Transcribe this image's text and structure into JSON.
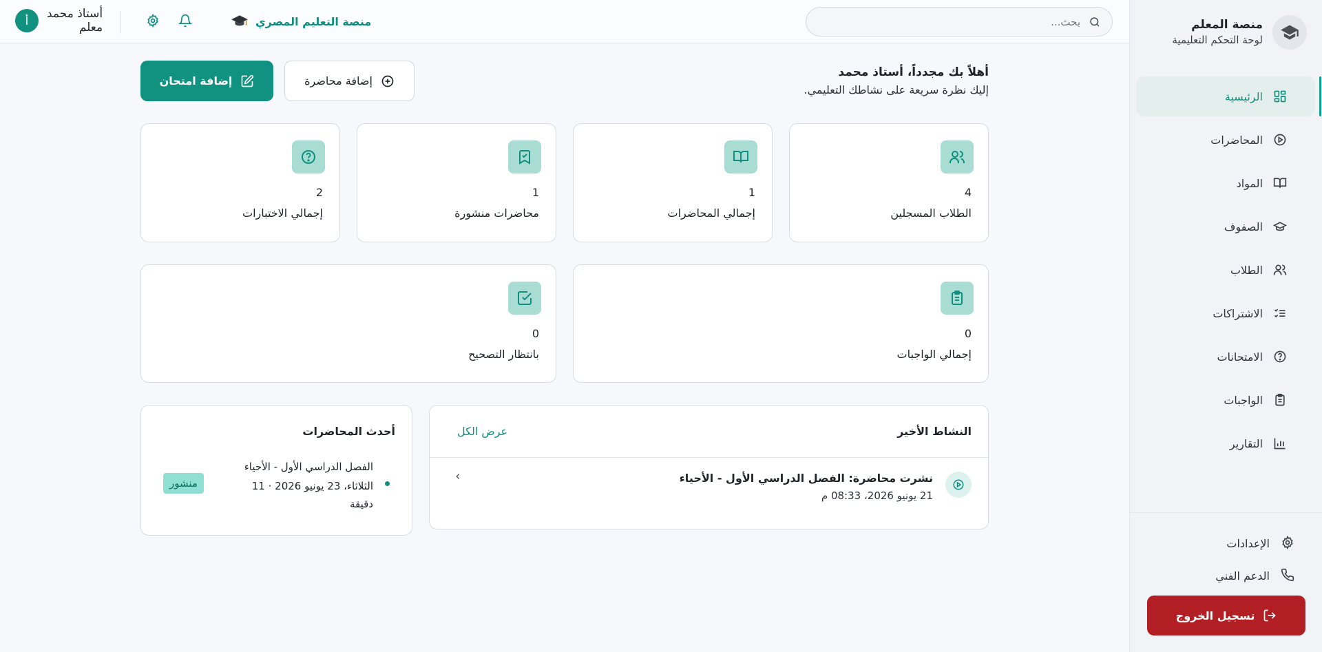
{
  "sidebar": {
    "brand_title": "منصة المعلم",
    "brand_subtitle": "لوحة التحكم التعليمية",
    "items": [
      {
        "label": "الرئيسية",
        "active": true
      },
      {
        "label": "المحاضرات"
      },
      {
        "label": "المواد"
      },
      {
        "label": "الصفوف"
      },
      {
        "label": "الطلاب"
      },
      {
        "label": "الاشتراكات"
      },
      {
        "label": "الامتحانات"
      },
      {
        "label": "الواجبات"
      },
      {
        "label": "التقارير"
      }
    ],
    "settings_label": "الإعدادات",
    "support_label": "الدعم الفني",
    "logout_label": "تسجيل الخروج"
  },
  "topbar": {
    "search_placeholder": "بحث...",
    "platform_name": "منصة التعليم المصري",
    "user_name": "أستاذ محمد",
    "user_role": "معلم",
    "user_initial": "أ"
  },
  "welcome": {
    "title": "أهلاً بك مجدداً، أستاذ محمد",
    "subtitle": "إليك نظرة سريعة على نشاطك التعليمي."
  },
  "actions": {
    "add_lecture": "إضافة محاضرة",
    "add_exam": "إضافة امتحان"
  },
  "stats": [
    {
      "value": "4",
      "label": "الطلاب المسجلين",
      "icon": "users-icon"
    },
    {
      "value": "1",
      "label": "إجمالي المحاضرات",
      "icon": "book-open-icon"
    },
    {
      "value": "1",
      "label": "محاضرات منشورة",
      "icon": "bookmark-check-icon"
    },
    {
      "value": "2",
      "label": "إجمالي الاختبارات",
      "icon": "help-circle-icon"
    },
    {
      "value": "0",
      "label": "إجمالي الواجبات",
      "icon": "clipboard-list-icon"
    },
    {
      "value": "0",
      "label": "بانتظار التصحيح",
      "icon": "check-square-icon"
    }
  ],
  "activity": {
    "title": "النشاط الأخير",
    "view_all": "عرض الكل",
    "items": [
      {
        "title": "نشرت محاضرة: الفصل الدراسي الأول - الأحياء",
        "date": "21 يونيو 2026، 08:33 م"
      }
    ]
  },
  "recent_lectures": {
    "title": "أحدث المحاضرات",
    "items": [
      {
        "name": "الفصل الدراسي الأول - الأحياء",
        "date": "الثلاثاء، 23 يونيو 2026 · 11",
        "duration": "دقيقة",
        "status": "منشور"
      }
    ]
  },
  "colors": {
    "accent": "#11917f",
    "danger": "#b11f24",
    "icon_bg": "#a9ddd4"
  }
}
